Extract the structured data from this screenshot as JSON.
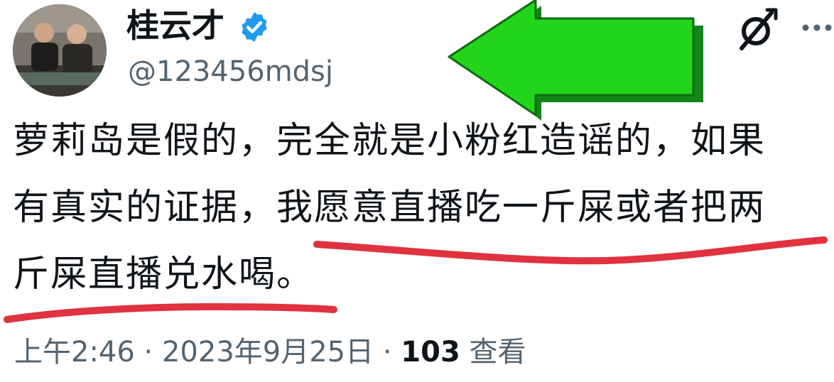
{
  "tweet": {
    "author": {
      "display_name": "桂云才",
      "handle": "@123456mdsj",
      "verified": true
    },
    "text_lines": [
      "萝莉岛是假的，完全就是小粉红造谣的，如果",
      "有真实的证据，我愿意直播吃一斤屎或者把两",
      "斤屎直播兑水喝。"
    ],
    "meta": {
      "time": "上午2:46",
      "separator": "·",
      "date": "2023年9月25日",
      "view_count": "103",
      "view_label": "查看"
    }
  },
  "icons": {
    "verified": "verified-badge-icon",
    "grok": "grok-icon",
    "more": "more-options-icon"
  },
  "colors": {
    "verified_badge": "#1d9bf0",
    "secondary_text": "#536471",
    "primary_text": "#0f1419",
    "arrow_fill": "#22d41a",
    "arrow_outline": "#15841a",
    "underline": "#e0323f"
  }
}
